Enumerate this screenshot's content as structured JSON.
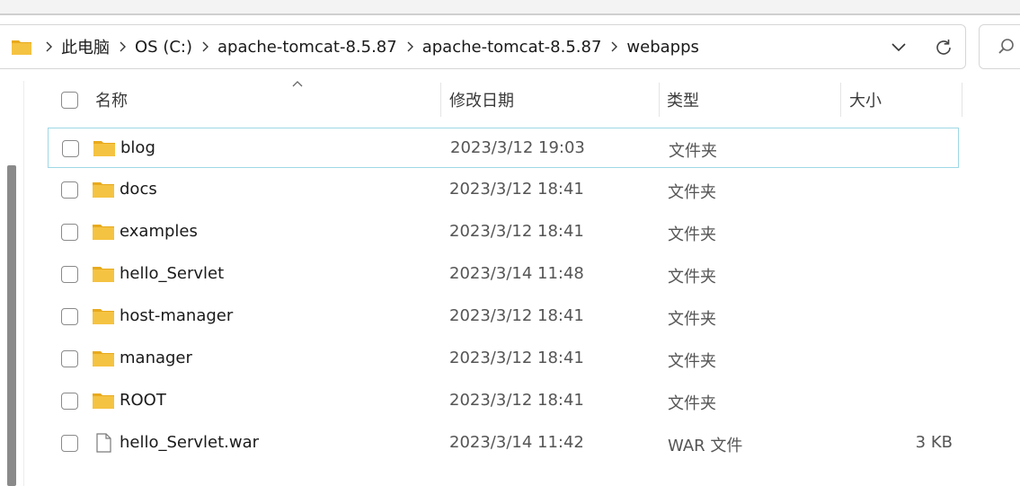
{
  "address": {
    "crumbs": [
      "此电脑",
      "OS (C:)",
      "apache-tomcat-8.5.87",
      "apache-tomcat-8.5.87",
      "webapps"
    ]
  },
  "header": {
    "name": "名称",
    "date": "修改日期",
    "type": "类型",
    "size": "大小"
  },
  "rows": [
    {
      "name": "blog",
      "date": "2023/3/12 19:03",
      "type": "文件夹",
      "size": "",
      "kind": "folder"
    },
    {
      "name": "docs",
      "date": "2023/3/12 18:41",
      "type": "文件夹",
      "size": "",
      "kind": "folder"
    },
    {
      "name": "examples",
      "date": "2023/3/12 18:41",
      "type": "文件夹",
      "size": "",
      "kind": "folder"
    },
    {
      "name": "hello_Servlet",
      "date": "2023/3/14 11:48",
      "type": "文件夹",
      "size": "",
      "kind": "folder"
    },
    {
      "name": "host-manager",
      "date": "2023/3/12 18:41",
      "type": "文件夹",
      "size": "",
      "kind": "folder"
    },
    {
      "name": "manager",
      "date": "2023/3/12 18:41",
      "type": "文件夹",
      "size": "",
      "kind": "folder"
    },
    {
      "name": "ROOT",
      "date": "2023/3/12 18:41",
      "type": "文件夹",
      "size": "",
      "kind": "folder"
    },
    {
      "name": "hello_Servlet.war",
      "date": "2023/3/14 11:42",
      "type": "WAR 文件",
      "size": "3 KB",
      "kind": "file"
    }
  ],
  "colors": {
    "folder": "#f5c342",
    "folder_dark": "#e8aa1c",
    "selection_border": "#9fd8e6"
  }
}
